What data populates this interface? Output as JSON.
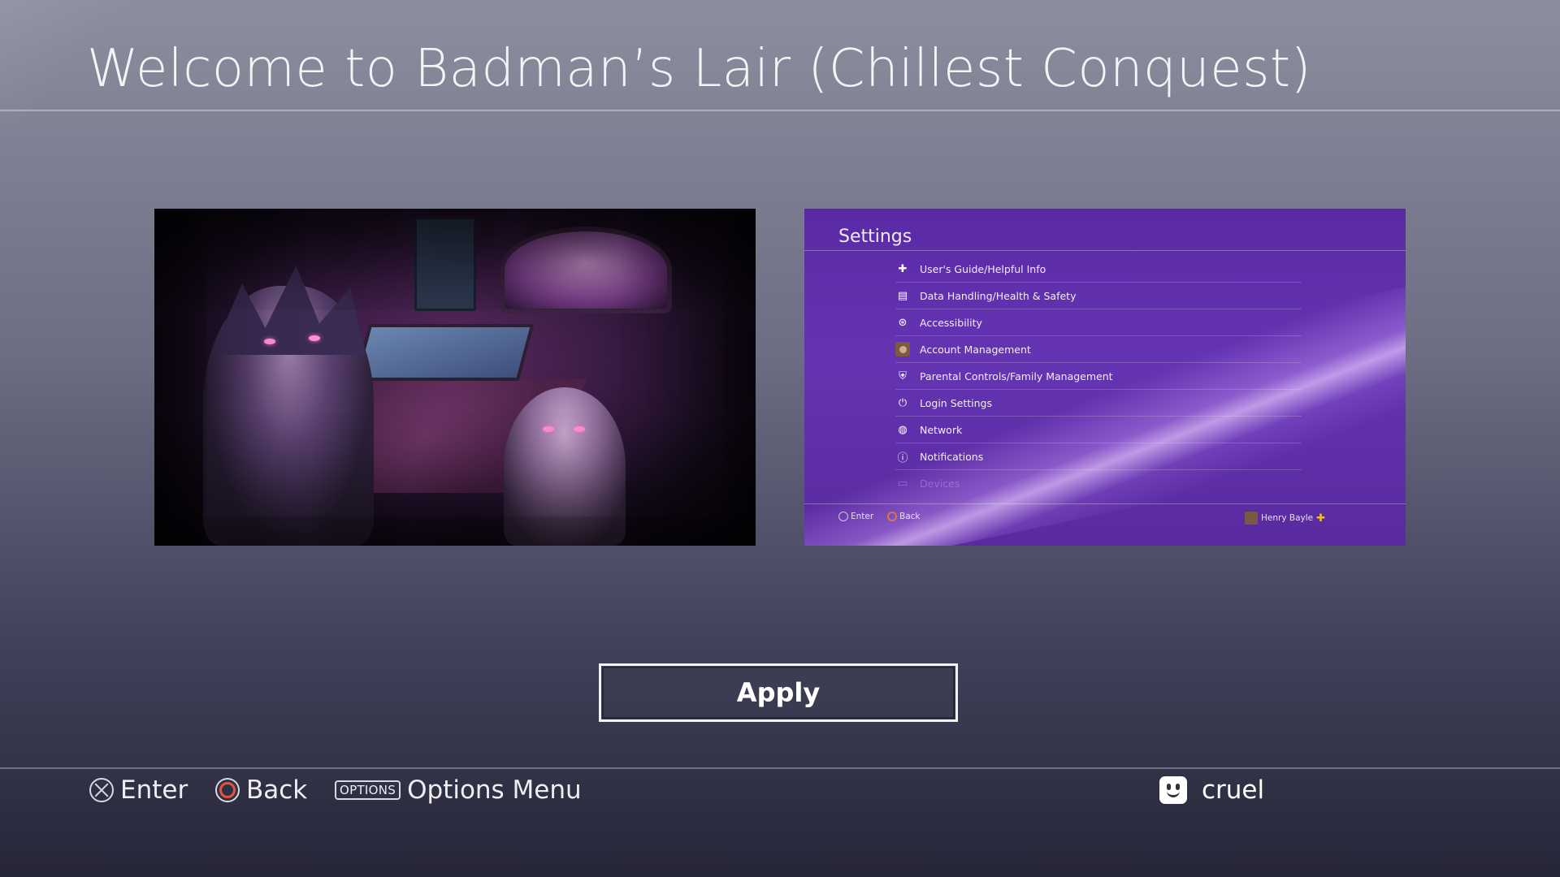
{
  "page": {
    "title": "Welcome to Badman’s Lair (Chillest Conquest)"
  },
  "settings_preview": {
    "title": "Settings",
    "items": [
      {
        "label": "User's Guide/Helpful Info",
        "icon": "help-icon"
      },
      {
        "label": "Data Handling/Health & Safety",
        "icon": "data-icon"
      },
      {
        "label": "Accessibility",
        "icon": "accessibility-icon"
      },
      {
        "label": "Account Management",
        "icon": "avatar-icon"
      },
      {
        "label": "Parental Controls/Family Management",
        "icon": "parental-icon"
      },
      {
        "label": "Login Settings",
        "icon": "login-icon"
      },
      {
        "label": "Network",
        "icon": "globe-icon"
      },
      {
        "label": "Notifications",
        "icon": "info-icon"
      },
      {
        "label": "Devices",
        "icon": "devices-icon"
      }
    ],
    "footer": {
      "enter": "Enter",
      "back": "Back",
      "user": "Henry Bayle"
    }
  },
  "apply_label": "Apply",
  "bottom_bar": {
    "enter": "Enter",
    "back": "Back",
    "options_key": "OPTIONS",
    "options": "Options Menu",
    "username": "cruel"
  },
  "colors": {
    "theme_purple": "#6434b2",
    "back_button": "#e2553a",
    "plus_gold": "#f3c020"
  }
}
